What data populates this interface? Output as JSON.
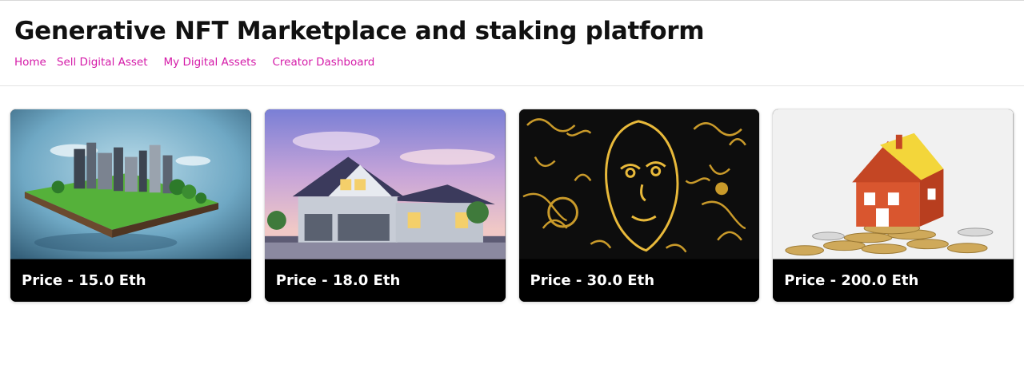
{
  "app": {
    "title": "Generative NFT Marketplace and staking platform"
  },
  "nav": {
    "items": [
      {
        "label": "Home"
      },
      {
        "label": "Sell Digital Asset"
      },
      {
        "label": "My Digital Assets"
      },
      {
        "label": "Creator Dashboard"
      }
    ]
  },
  "colors": {
    "nav_link": "#d41aa8",
    "price_bar": "#000000"
  },
  "nfts": [
    {
      "price_label": "Price - 15.0 Eth",
      "image": "floating-city-island"
    },
    {
      "price_label": "Price - 18.0 Eth",
      "image": "suburban-house-dusk"
    },
    {
      "price_label": "Price - 30.0 Eth",
      "image": "gold-line-art-face"
    },
    {
      "price_label": "Price - 200.0 Eth",
      "image": "toy-house-on-coins"
    }
  ]
}
